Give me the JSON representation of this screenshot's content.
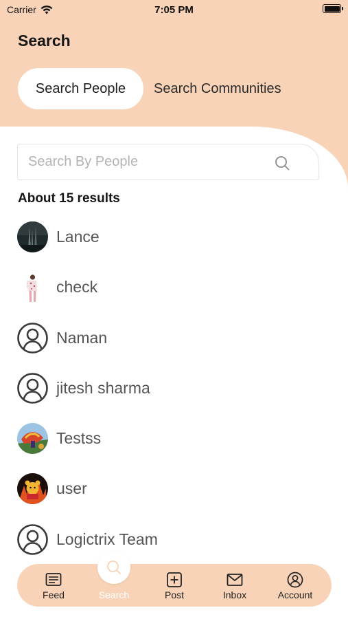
{
  "status_bar": {
    "carrier": "Carrier",
    "time": "7:05 PM",
    "battery_level": 1.0
  },
  "header": {
    "title": "Search"
  },
  "tabs": [
    {
      "label": "Search People",
      "selected": true
    },
    {
      "label": "Search Communities",
      "selected": false
    }
  ],
  "search": {
    "placeholder": "Search By People",
    "value": "",
    "icon": "search-icon"
  },
  "results": {
    "summary": "About 15 results",
    "people": [
      {
        "name": "Lance",
        "avatar": "photo-dark"
      },
      {
        "name": "check",
        "avatar": "photo-standing-person"
      },
      {
        "name": "Naman",
        "avatar": "default-user-icon"
      },
      {
        "name": "jitesh sharma",
        "avatar": "default-user-icon"
      },
      {
        "name": "Testss",
        "avatar": "photo-colorful"
      },
      {
        "name": "user",
        "avatar": "photo-cartoon-bear"
      },
      {
        "name": "Logictrix Team",
        "avatar": "default-user-icon"
      }
    ]
  },
  "bottom_nav": {
    "items": [
      {
        "label": "Feed",
        "icon": "feed-icon",
        "active": false
      },
      {
        "label": "Search",
        "icon": "search-icon",
        "active": true
      },
      {
        "label": "Post",
        "icon": "add-square-icon",
        "active": false
      },
      {
        "label": "Inbox",
        "icon": "mail-icon",
        "active": false
      },
      {
        "label": "Account",
        "icon": "account-icon",
        "active": false
      }
    ]
  },
  "colors": {
    "accent": "#f8d3b7",
    "background": "#ffffff",
    "name_text": "#555555",
    "placeholder_text": "#b3b3b3"
  }
}
